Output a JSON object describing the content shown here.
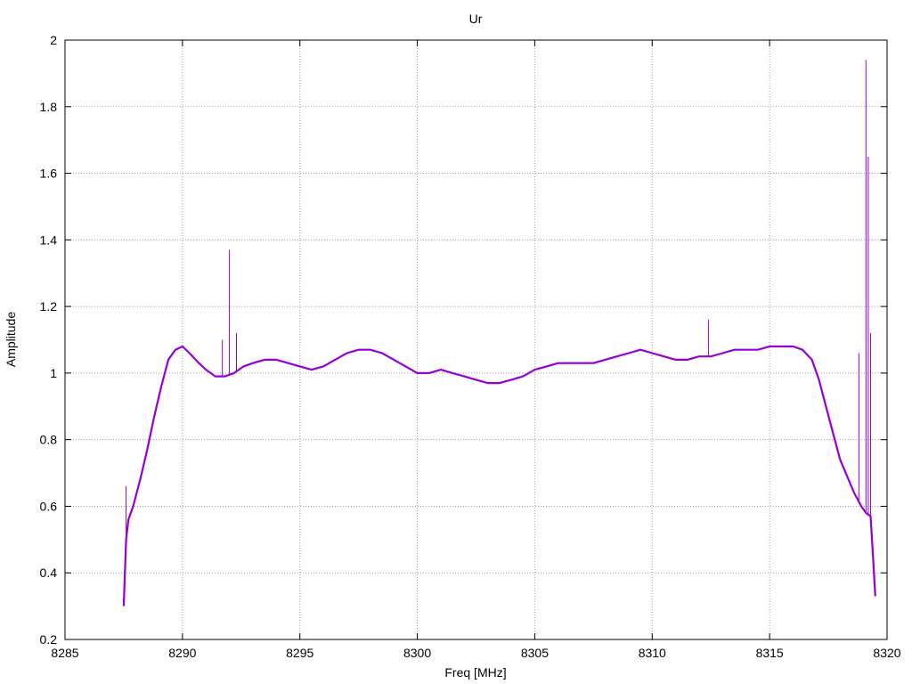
{
  "chart_data": {
    "type": "line",
    "title": "Ur",
    "xlabel": "Freq [MHz]",
    "ylabel": "Amplitude",
    "xlim": [
      8285,
      8320
    ],
    "ylim": [
      0.2,
      2.0
    ],
    "xticks": [
      8285,
      8290,
      8295,
      8300,
      8305,
      8310,
      8315,
      8320
    ],
    "yticks": [
      0.2,
      0.4,
      0.6,
      0.8,
      1.0,
      1.2,
      1.4,
      1.6,
      1.8,
      2.0
    ],
    "ytick_labels": [
      "0.2",
      "0.4",
      "0.6",
      "0.8",
      "1",
      "1.2",
      "1.4",
      "1.6",
      "1.8",
      "2"
    ],
    "grid": true,
    "line_color": "#9400d3",
    "series": [
      {
        "x": [
          8287.5,
          8287.6,
          8287.7,
          8287.9,
          8288.2,
          8288.5,
          8288.8,
          8289.1,
          8289.4,
          8289.7,
          8290.0,
          8290.3,
          8290.7,
          8291.0,
          8291.4,
          8291.8,
          8292.2,
          8292.6,
          8293.0,
          8293.5,
          8294.0,
          8294.5,
          8295.0,
          8295.5,
          8296.0,
          8296.5,
          8297.0,
          8297.5,
          8298.0,
          8298.5,
          8299.0,
          8299.5,
          8300.0,
          8300.5,
          8301.0,
          8301.5,
          8302.0,
          8302.5,
          8303.0,
          8303.5,
          8304.0,
          8304.5,
          8305.0,
          8305.5,
          8306.0,
          8306.5,
          8307.0,
          8307.5,
          8308.0,
          8308.5,
          8309.0,
          8309.5,
          8310.0,
          8310.5,
          8311.0,
          8311.5,
          8312.0,
          8312.5,
          8313.0,
          8313.5,
          8314.0,
          8314.5,
          8315.0,
          8315.5,
          8316.0,
          8316.4,
          8316.8,
          8317.1,
          8317.4,
          8317.7,
          8318.0,
          8318.3,
          8318.6,
          8318.9,
          8319.1,
          8319.3,
          8319.4,
          8319.5
        ],
        "y": [
          0.3,
          0.5,
          0.56,
          0.6,
          0.68,
          0.77,
          0.87,
          0.96,
          1.04,
          1.07,
          1.08,
          1.06,
          1.03,
          1.01,
          0.99,
          0.99,
          1.0,
          1.02,
          1.03,
          1.04,
          1.04,
          1.03,
          1.02,
          1.01,
          1.02,
          1.04,
          1.06,
          1.07,
          1.07,
          1.06,
          1.04,
          1.02,
          1.0,
          1.0,
          1.01,
          1.0,
          0.99,
          0.98,
          0.97,
          0.97,
          0.98,
          0.99,
          1.01,
          1.02,
          1.03,
          1.03,
          1.03,
          1.03,
          1.04,
          1.05,
          1.06,
          1.07,
          1.06,
          1.05,
          1.04,
          1.04,
          1.05,
          1.05,
          1.06,
          1.07,
          1.07,
          1.07,
          1.08,
          1.08,
          1.08,
          1.07,
          1.04,
          0.98,
          0.9,
          0.82,
          0.74,
          0.69,
          0.64,
          0.6,
          0.58,
          0.57,
          0.45,
          0.33
        ],
        "spikes": [
          {
            "x": 8287.6,
            "y": 0.66
          },
          {
            "x": 8291.7,
            "y": 1.1
          },
          {
            "x": 8292.0,
            "y": 1.37
          },
          {
            "x": 8292.3,
            "y": 1.12
          },
          {
            "x": 8312.4,
            "y": 1.16
          },
          {
            "x": 8318.8,
            "y": 1.06
          },
          {
            "x": 8319.1,
            "y": 1.94
          },
          {
            "x": 8319.2,
            "y": 1.65
          },
          {
            "x": 8319.3,
            "y": 1.12
          }
        ]
      }
    ]
  }
}
